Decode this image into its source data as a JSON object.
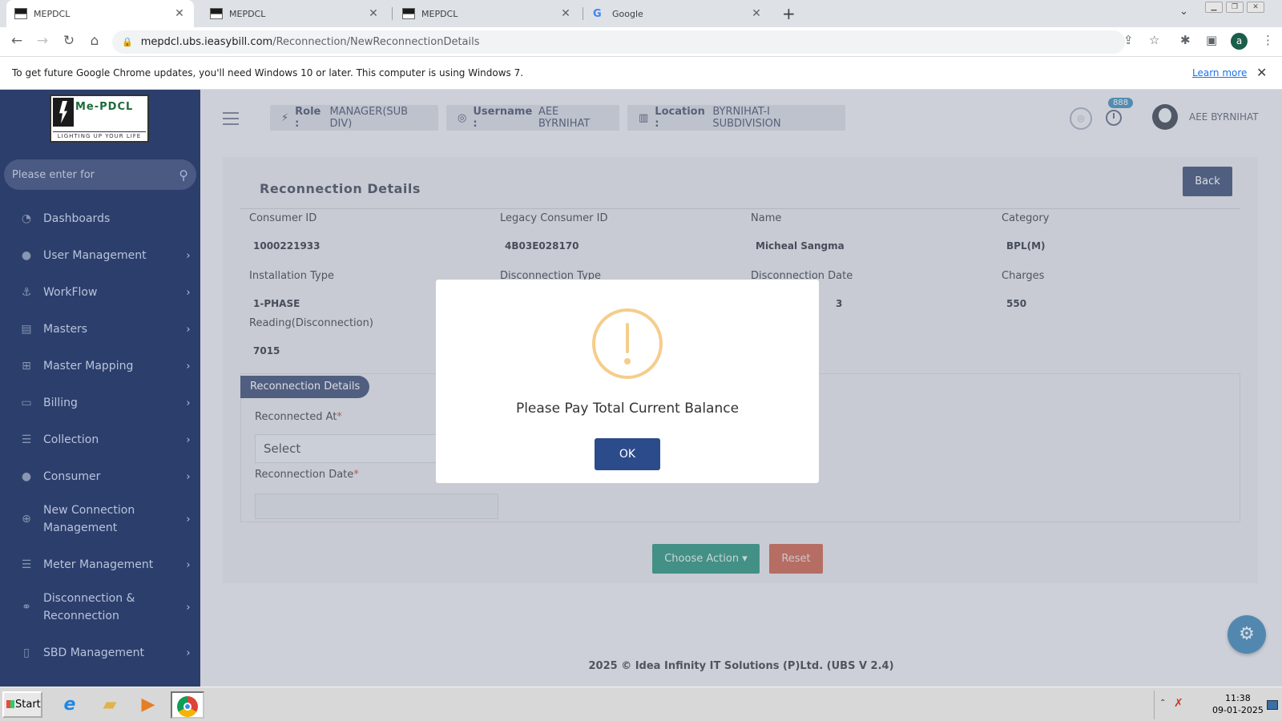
{
  "browser": {
    "tabs": [
      {
        "title": "MEPDCL",
        "active": true
      },
      {
        "title": "MEPDCL",
        "active": false
      },
      {
        "title": "MEPDCL",
        "active": false
      },
      {
        "title": "Google",
        "active": false
      }
    ],
    "url_host": "mepdcl.ubs.ieasybill.com",
    "url_path": "/Reconnection/NewReconnectionDetails",
    "profile_initial": "a",
    "infobar_message": "To get future Google Chrome updates, you'll need Windows 10 or later. This computer is using Windows 7.",
    "infobar_link": "Learn more"
  },
  "sidebar": {
    "logo_text": "Me-PDCL",
    "logo_tagline": "LIGHTING UP YOUR LIFE",
    "search_placeholder": "Please enter for",
    "items": [
      {
        "label": "Dashboards",
        "icon": "dashboard-icon",
        "glyph": "◔",
        "has_chevron": false
      },
      {
        "label": "User Management",
        "icon": "user-icon",
        "glyph": "●",
        "has_chevron": true
      },
      {
        "label": "WorkFlow",
        "icon": "anchor-icon",
        "glyph": "⚓",
        "has_chevron": true
      },
      {
        "label": "Masters",
        "icon": "masters-icon",
        "glyph": "▤",
        "has_chevron": true
      },
      {
        "label": "Master Mapping",
        "icon": "sitemap-icon",
        "glyph": "⊞",
        "has_chevron": true
      },
      {
        "label": "Billing",
        "icon": "monitor-icon",
        "glyph": "▭",
        "has_chevron": true
      },
      {
        "label": "Collection",
        "icon": "list-icon",
        "glyph": "☰",
        "has_chevron": true
      },
      {
        "label": "Consumer",
        "icon": "user-icon",
        "glyph": "●",
        "has_chevron": true
      },
      {
        "label": "New Connection Management",
        "icon": "plus-circle-icon",
        "glyph": "⊕",
        "has_chevron": true
      },
      {
        "label": "Meter Management",
        "icon": "list-icon",
        "glyph": "☰",
        "has_chevron": true
      },
      {
        "label": "Disconnection & Reconnection",
        "icon": "link-icon",
        "glyph": "⚭",
        "has_chevron": true
      },
      {
        "label": "SBD Management",
        "icon": "box-icon",
        "glyph": "▯",
        "has_chevron": true
      }
    ]
  },
  "topbar": {
    "role_label": "Role :",
    "role_value": "MANAGER(SUB DIV)",
    "username_label": "Username :",
    "username_value": "AEE BYRNIHAT",
    "location_label": "Location :",
    "location_value": "BYRNIHAT-I SUBDIVISION",
    "notification_count": "888",
    "user_name": "AEE BYRNIHAT"
  },
  "details": {
    "title": "Reconnection Details",
    "back_label": "Back",
    "fields": [
      {
        "label": "Consumer ID",
        "value": "1000221933"
      },
      {
        "label": "Legacy Consumer ID",
        "value": "4B03E028170"
      },
      {
        "label": "Name",
        "value": "Micheal Sangma"
      },
      {
        "label": "Category",
        "value": "BPL(M)"
      },
      {
        "label": "Installation Type",
        "value": "1-PHASE"
      },
      {
        "label": "Disconnection Type",
        "value": ""
      },
      {
        "label": "Disconnection Date",
        "value": "3"
      },
      {
        "label": "Charges",
        "value": "550"
      },
      {
        "label": "Reading(Disconnection)",
        "value": "7015"
      }
    ]
  },
  "reconnection_form": {
    "section_title": "Reconnection Details",
    "reconnected_at_label": "Reconnected At",
    "reconnected_at_value": "Select",
    "reconnection_date_label": "Reconnection Date",
    "required_marker": "*",
    "choose_action_label": "Choose Action",
    "reset_label": "Reset"
  },
  "footer": {
    "text": "2025 © Idea Infinity IT Solutions (P)Ltd. (UBS V 2.4)"
  },
  "dialog": {
    "message": "Please Pay Total Current Balance",
    "ok_label": "OK"
  },
  "taskbar": {
    "start_label": "Start",
    "time": "11:38",
    "date": "09-01-2025"
  },
  "colors": {
    "sidebar_bg": "#2c3e6b",
    "primary": "#2c3e6b",
    "action_green": "#178a73",
    "reset_red": "#c8553e",
    "warning": "#f5cd8a"
  }
}
